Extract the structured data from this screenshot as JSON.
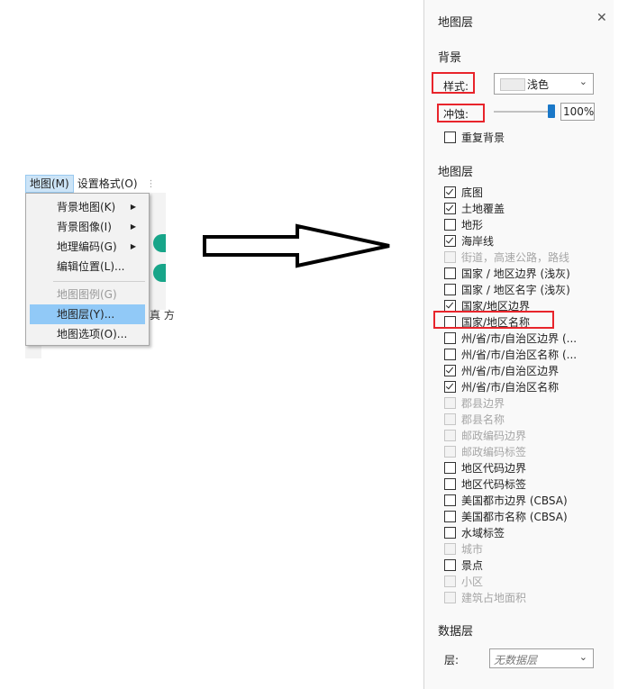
{
  "menubar": {
    "items": [
      {
        "label": "地图(M)",
        "active": true
      },
      {
        "label": "设置格式(O)",
        "active": false
      }
    ]
  },
  "map_menu": {
    "items": [
      {
        "label": "背景地图(K)",
        "submenu": true,
        "disabled": false,
        "highlighted": false
      },
      {
        "label": "背景图像(I)",
        "submenu": true,
        "disabled": false,
        "highlighted": false
      },
      {
        "label": "地理编码(G)",
        "submenu": true,
        "disabled": false,
        "highlighted": false
      },
      {
        "label": "编辑位置(L)...",
        "submenu": false,
        "disabled": false,
        "highlighted": false
      },
      {
        "label": "地图图例(G)",
        "submenu": false,
        "disabled": true,
        "highlighted": false
      },
      {
        "label": "地图层(Y)...",
        "submenu": false,
        "disabled": false,
        "highlighted": true
      },
      {
        "label": "地图选项(O)...",
        "submenu": false,
        "disabled": false,
        "highlighted": false
      }
    ],
    "behind_text": "真 方"
  },
  "panel": {
    "title": "地图层",
    "close_icon": "close-icon",
    "background": {
      "heading": "背景",
      "style_label": "样式:",
      "style_value": "浅色",
      "washout_label": "冲蚀:",
      "washout_value": "100%",
      "washout_level": 1.0,
      "repeat_label": "重复背景",
      "repeat_checked": false
    },
    "map_layers": {
      "heading": "地图层",
      "items": [
        {
          "label": "底图",
          "checked": true,
          "disabled": false
        },
        {
          "label": "土地覆盖",
          "checked": true,
          "disabled": false
        },
        {
          "label": "地形",
          "checked": false,
          "disabled": false
        },
        {
          "label": "海岸线",
          "checked": true,
          "disabled": false
        },
        {
          "label": "街道，高速公路，路线",
          "checked": false,
          "disabled": true
        },
        {
          "label": "国家 / 地区边界 (浅灰)",
          "checked": false,
          "disabled": false
        },
        {
          "label": "国家 / 地区名字 (浅灰)",
          "checked": false,
          "disabled": false
        },
        {
          "label": "国家/地区边界",
          "checked": true,
          "disabled": false
        },
        {
          "label": "国家/地区名称",
          "checked": false,
          "disabled": false
        },
        {
          "label": "州/省/市/自治区边界 (...",
          "checked": false,
          "disabled": false
        },
        {
          "label": "州/省/市/自治区名称 (...",
          "checked": false,
          "disabled": false
        },
        {
          "label": "州/省/市/自治区边界",
          "checked": true,
          "disabled": false
        },
        {
          "label": "州/省/市/自治区名称",
          "checked": true,
          "disabled": false
        },
        {
          "label": "郡县边界",
          "checked": false,
          "disabled": true
        },
        {
          "label": "郡县名称",
          "checked": false,
          "disabled": true
        },
        {
          "label": "邮政编码边界",
          "checked": false,
          "disabled": true
        },
        {
          "label": "邮政编码标签",
          "checked": false,
          "disabled": true
        },
        {
          "label": "地区代码边界",
          "checked": false,
          "disabled": false
        },
        {
          "label": "地区代码标签",
          "checked": false,
          "disabled": false
        },
        {
          "label": "美国都市边界 (CBSA)",
          "checked": false,
          "disabled": false
        },
        {
          "label": "美国都市名称 (CBSA)",
          "checked": false,
          "disabled": false
        },
        {
          "label": "水域标签",
          "checked": false,
          "disabled": false
        },
        {
          "label": "城市",
          "checked": false,
          "disabled": true
        },
        {
          "label": "景点",
          "checked": false,
          "disabled": false
        },
        {
          "label": "小区",
          "checked": false,
          "disabled": true
        },
        {
          "label": "建筑占地面积",
          "checked": false,
          "disabled": true
        }
      ]
    },
    "data_layers": {
      "heading": "数据层",
      "layer_label": "层:",
      "layer_placeholder": "无数据层"
    }
  },
  "colors": {
    "highlight_box": "#e8242b",
    "menu_highlight": "#91c9f7",
    "slider_thumb": "#1a78c8",
    "green_marker": "#17a589"
  }
}
